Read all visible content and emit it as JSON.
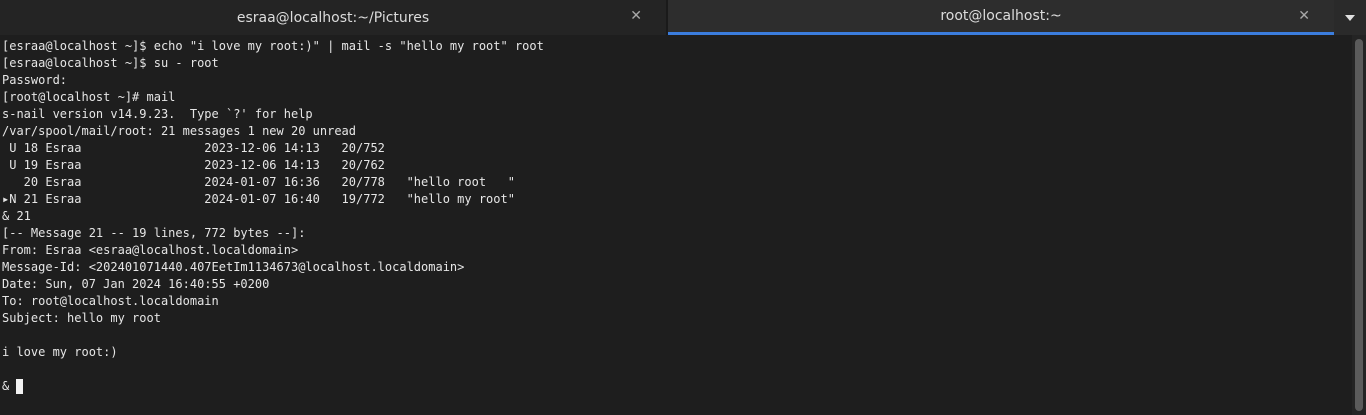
{
  "tabs": [
    {
      "title": "esraa@localhost:~/Pictures",
      "close_glyph": "✕",
      "active": false
    },
    {
      "title": "root@localhost:~",
      "close_glyph": "✕",
      "active": true
    }
  ],
  "menu_icon": "chevron-down-icon",
  "colors": {
    "background": "#1e1e1e",
    "text": "#e6e6e6",
    "active_tab_accent": "#3b7ddd"
  },
  "terminal": {
    "lines": [
      "[esraa@localhost ~]$ echo \"i love my root:)\" | mail -s \"hello my root\" root",
      "[esraa@localhost ~]$ su - root",
      "Password:",
      "[root@localhost ~]# mail",
      "s-nail version v14.9.23.  Type `?' for help",
      "/var/spool/mail/root: 21 messages 1 new 20 unread",
      " U 18 Esraa                 2023-12-06 14:13   20/752",
      " U 19 Esraa                 2023-12-06 14:13   20/762",
      "   20 Esraa                 2024-01-07 16:36   20/778   \"hello root   \"",
      "▸N 21 Esraa                 2024-01-07 16:40   19/772   \"hello my root\"",
      "& 21",
      "[-- Message 21 -- 19 lines, 772 bytes --]:",
      "From: Esraa <esraa@localhost.localdomain>",
      "Message-Id: <202401071440.407EetIm1134673@localhost.localdomain>",
      "Date: Sun, 07 Jan 2024 16:40:55 +0200",
      "To: root@localhost.localdomain",
      "Subject: hello my root",
      "",
      "i love my root:)",
      "",
      "& "
    ]
  }
}
